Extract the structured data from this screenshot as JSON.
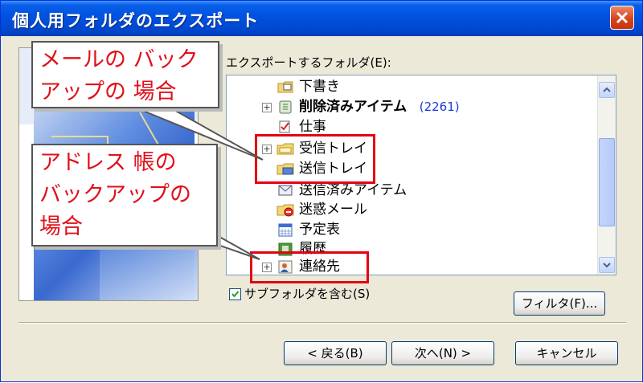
{
  "window": {
    "title": "個人用フォルダのエクスポート"
  },
  "folder_label": "エクスポートするフォルダ(E):",
  "tree_items": [
    {
      "label": "下書き",
      "bold": false,
      "expandable": false,
      "icon": "drafts-icon"
    },
    {
      "label": "削除済みアイテム",
      "bold": true,
      "expandable": true,
      "count": "(2261)",
      "icon": "deleted-items-icon"
    },
    {
      "label": "仕事",
      "bold": false,
      "expandable": false,
      "icon": "tasks-icon"
    },
    {
      "label": "受信トレイ",
      "bold": false,
      "expandable": true,
      "icon": "inbox-icon"
    },
    {
      "label": "送信トレイ",
      "bold": false,
      "expandable": false,
      "icon": "outbox-icon"
    },
    {
      "label": "送信済みアイテム",
      "bold": false,
      "expandable": false,
      "icon": "sent-items-icon"
    },
    {
      "label": "迷惑メール",
      "bold": false,
      "expandable": false,
      "icon": "junk-mail-icon"
    },
    {
      "label": "予定表",
      "bold": false,
      "expandable": false,
      "icon": "calendar-icon"
    },
    {
      "label": "履歴",
      "bold": false,
      "expandable": false,
      "icon": "journal-icon"
    },
    {
      "label": "連絡先",
      "bold": false,
      "expandable": true,
      "icon": "contacts-icon"
    }
  ],
  "include_subfolders": {
    "label": "サブフォルダを含む(S)",
    "checked": true
  },
  "buttons": {
    "filter": "フィルタ(F)...",
    "back": "< 戻る(B)",
    "next": "次へ(N) >",
    "cancel": "キャンセル"
  },
  "callouts": {
    "mail": {
      "line1": "メールの バック",
      "line2": "アップの 場合"
    },
    "address": {
      "line1": "アドレス 帳の",
      "line2": "バックアップの",
      "line3": "場合"
    }
  },
  "colors": {
    "titlebar": "#0053e1",
    "highlight": "#e50014",
    "callout_text": "#e0111a",
    "dialog_bg": "#ece9d8"
  }
}
